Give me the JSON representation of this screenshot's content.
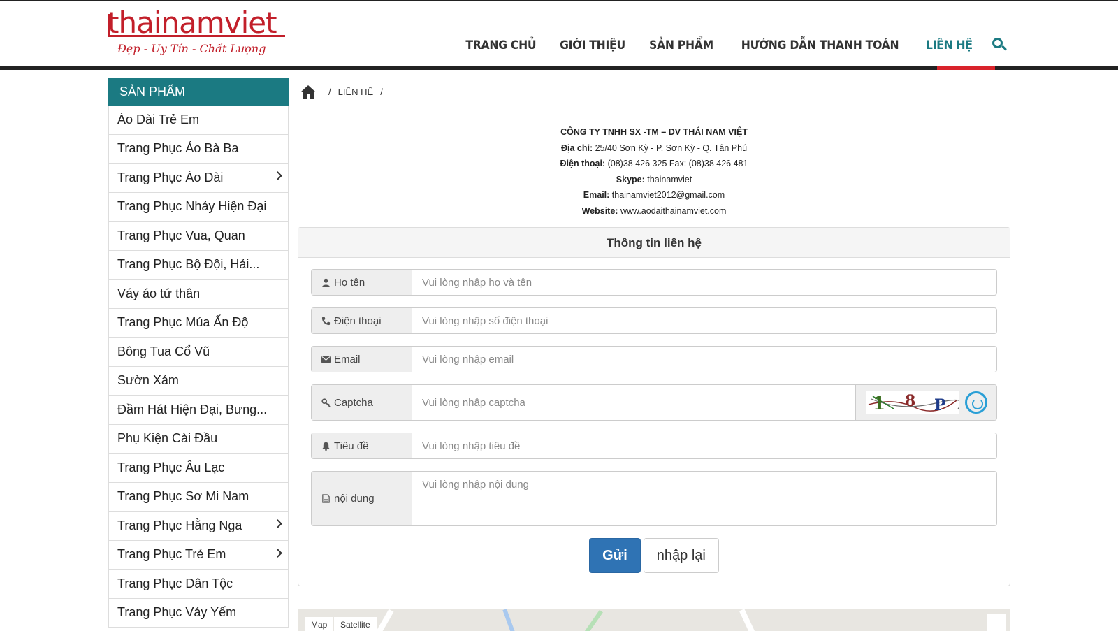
{
  "brand": {
    "name_left": "thai",
    "name_right": "namviet",
    "slogan": "Đẹp - Uy Tín - Chất Lượng",
    "accent": "#c21f2a",
    "teal": "#1b7a82"
  },
  "nav": {
    "items": [
      "TRANG CHỦ",
      "GIỚI THIỆU",
      "SẢN PHẨM",
      "HƯỚNG DẪN THANH TOÁN",
      "LIÊN HỆ"
    ],
    "active": "LIÊN HỆ"
  },
  "sidebar": {
    "title": "SẢN PHẨM",
    "items": [
      {
        "label": "Áo Dài Trẻ Em",
        "has_children": false
      },
      {
        "label": "Trang Phục Áo Bà Ba",
        "has_children": false
      },
      {
        "label": "Trang Phục Áo Dài",
        "has_children": true
      },
      {
        "label": "Trang Phục Nhảy Hiện Đại",
        "has_children": false
      },
      {
        "label": "Trang Phục Vua, Quan",
        "has_children": false
      },
      {
        "label": "Trang Phục Bộ Đội, Hải...",
        "has_children": false
      },
      {
        "label": "Váy áo tứ thân",
        "has_children": false
      },
      {
        "label": "Trang Phục Múa Ấn Độ",
        "has_children": false
      },
      {
        "label": "Bông Tua Cổ Vũ",
        "has_children": false
      },
      {
        "label": "Sườn Xám",
        "has_children": false
      },
      {
        "label": "Đầm Hát Hiện Đại, Bưng...",
        "has_children": false
      },
      {
        "label": "Phụ Kiện Cài Đầu",
        "has_children": false
      },
      {
        "label": "Trang Phục Âu Lạc",
        "has_children": false
      },
      {
        "label": "Trang Phục Sơ Mi Nam",
        "has_children": false
      },
      {
        "label": "Trang Phục Hằng Nga",
        "has_children": true
      },
      {
        "label": "Trang Phục Trẻ Em",
        "has_children": true
      },
      {
        "label": "Trang Phục Dân Tộc",
        "has_children": false
      },
      {
        "label": "Trang Phục Váy Yếm",
        "has_children": false
      }
    ]
  },
  "breadcrumb": {
    "sep": "/",
    "current": "LIÊN HỆ"
  },
  "company": {
    "name": "CÔNG TY TNHH SX -TM – DV THÁI NAM VIỆT",
    "address_label": "Địa chỉ:",
    "address": "25/40 Sơn Kỳ - P. Sơn Kỳ - Q. Tân Phú",
    "phone_label": "Điện thoại:",
    "phone": "(08)38 426 325 Fax: (08)38 426 481",
    "skype_label": "Skype:",
    "skype": "thainamviet",
    "email_label": "Email:",
    "email": "thainamviet2012@gmail.com",
    "website_label": "Website:",
    "website": "www.aodaithainamviet.com"
  },
  "form": {
    "title": "Thông tin liên hệ",
    "name_label": "Họ tên",
    "name_placeholder": "Vui lòng nhập họ và tên",
    "phone_label": "Điện thoại",
    "phone_placeholder": "Vui lòng nhập số điện thoại",
    "email_label": "Email",
    "email_placeholder": "Vui lòng nhập email",
    "captcha_label": "Captcha",
    "captcha_placeholder": "Vui lòng nhập captcha",
    "captcha_code": "18P",
    "subject_label": "Tiêu đề",
    "subject_placeholder": "Vui lòng nhập tiêu đề",
    "content_label": "nội dung",
    "content_placeholder": "Vui lòng nhập nội dung",
    "submit_label": "Gửi",
    "reset_label": "nhập lại"
  },
  "map": {
    "map_tab": "Map",
    "satellite_tab": "Satellite"
  }
}
